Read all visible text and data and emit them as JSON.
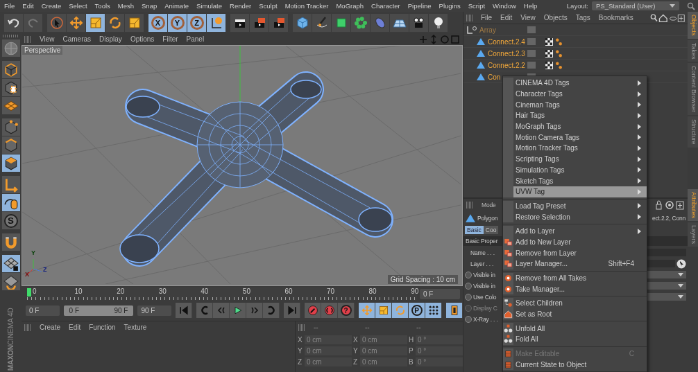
{
  "menubar": {
    "items": [
      "File",
      "Edit",
      "Create",
      "Select",
      "Tools",
      "Mesh",
      "Snap",
      "Animate",
      "Simulate",
      "Render",
      "Sculpt",
      "Motion Tracker",
      "MoGraph",
      "Character",
      "Pipeline",
      "Plugins",
      "Script",
      "Window",
      "Help"
    ],
    "layout_label": "Layout:",
    "layout_value": "PS_Standard (User)"
  },
  "toolbar": [
    [
      {
        "selected": false
      },
      {
        "selected": false
      }
    ],
    [
      {
        "selected": false
      },
      {
        "selected": false
      },
      {
        "selected": true
      },
      {
        "selected": false
      },
      {
        "selected": false
      }
    ],
    [
      {
        "label": "X",
        "selected": true
      },
      {
        "label": "Y",
        "selected": true
      },
      {
        "label": "Z",
        "selected": true
      },
      {
        "selected": true
      }
    ],
    [
      {
        "selected": false
      },
      {
        "selected": false
      },
      {
        "selected": false
      }
    ],
    [
      {
        "selected": false
      },
      {
        "selected": false
      },
      {
        "selected": false
      },
      {
        "selected": false
      },
      {
        "selected": false
      },
      {
        "selected": false
      },
      {
        "selected": false
      },
      {
        "selected": false
      }
    ]
  ],
  "left_toolbar": [
    {
      "selected": false
    },
    {
      "selected": false
    },
    {
      "selected": false
    },
    {
      "selected": false
    },
    {
      "selected": false
    },
    {
      "selected": false
    },
    {
      "selected": true
    },
    {
      "selected": false
    },
    {
      "selected": true
    },
    {
      "label": "S",
      "selected": false
    },
    {
      "selected": false
    },
    {
      "selected": true
    },
    {
      "selected": false
    }
  ],
  "viewport": {
    "menus": [
      "View",
      "Cameras",
      "Display",
      "Options",
      "Filter",
      "Panel"
    ],
    "camera": "Perspective",
    "axis_labels": [
      "Y",
      "Z",
      "X"
    ],
    "grid_spacing": "Grid Spacing : 10 cm"
  },
  "timeline": {
    "ticks": [
      "0",
      "10",
      "20",
      "30",
      "40",
      "50",
      "60",
      "70",
      "80",
      "90"
    ],
    "current_frame": "0 F",
    "start": "0 F",
    "range": {
      "start": "0 F",
      "end": "90 F",
      "level": 1
    },
    "end": "90 F",
    "controls": [
      [
        {
          "selected": false
        }
      ],
      [
        {
          "selected": false
        },
        {
          "selected": false
        },
        {
          "selected": false
        },
        {
          "selected": false
        },
        {
          "selected": false
        }
      ],
      [
        {
          "selected": false
        }
      ],
      [
        {
          "selected": false
        },
        {
          "selected": false
        },
        {
          "label": "?",
          "selected": false
        }
      ],
      [
        {
          "selected": true
        },
        {
          "selected": true
        },
        {
          "selected": true
        },
        {
          "label": "P",
          "selected": true
        },
        {
          "selected": true
        }
      ],
      [
        {
          "selected": true
        }
      ]
    ]
  },
  "material_manager": {
    "menus": [
      "Create",
      "Edit",
      "Function",
      "Texture"
    ]
  },
  "coordinates": {
    "headers": [
      "--",
      "--",
      "--"
    ],
    "rows": [
      [
        {
          "axis": "X",
          "value": "0 cm"
        },
        {
          "axis": "X",
          "value": "0 cm"
        },
        {
          "axis": "H",
          "value": "0 °"
        }
      ],
      [
        {
          "axis": "Y",
          "value": "0 cm"
        },
        {
          "axis": "Y",
          "value": "0 cm"
        },
        {
          "axis": "P",
          "value": "0 °"
        }
      ],
      [
        {
          "axis": "Z",
          "value": "0 cm"
        },
        {
          "axis": "Z",
          "value": "0 cm"
        },
        {
          "axis": "B",
          "value": "0 °"
        }
      ]
    ]
  },
  "logo": [
    "MAXON",
    "CINEMA 4D"
  ],
  "object_manager": {
    "menus": [
      "File",
      "Edit",
      "View",
      "Objects",
      "Tags",
      "Bookmarks"
    ],
    "objects": [
      {
        "name": "Array",
        "selected": false,
        "children": [
          {
            "name": "Connect.2.4",
            "selected": true,
            "tags": [
              {
                "kind": "texture"
              },
              {
                "kind": "phong"
              }
            ]
          },
          {
            "name": "Connect.2.3",
            "selected": true,
            "tags": [
              {
                "kind": "texture"
              },
              {
                "kind": "phong"
              }
            ]
          },
          {
            "name": "Connect.2.2",
            "selected": true,
            "tags": [
              {
                "kind": "texture"
              },
              {
                "kind": "phong"
              }
            ]
          },
          {
            "name": "Con",
            "selected": true
          }
        ]
      }
    ]
  },
  "attributes": {
    "mode": "Mode",
    "object": "Polygon",
    "object_names": "ect.2.2, Conn",
    "tabs": [
      {
        "label": "Basic",
        "selected": true
      },
      {
        "label": "Coo",
        "selected": false
      }
    ],
    "section": "Basic Proper",
    "fields": [
      {
        "label": "Name . . .",
        "kind": "text",
        "disabled": false
      },
      {
        "label": "Layer . . .",
        "kind": "layer",
        "disabled": false
      },
      {
        "label": "Visible in",
        "kind": "dropdown",
        "disabled": false
      },
      {
        "label": "Visible in",
        "kind": "dropdown",
        "disabled": false
      },
      {
        "label": "Use Colo",
        "kind": "dropdown",
        "disabled": false
      },
      {
        "label": "Display C",
        "kind": "radio",
        "disabled": true
      },
      {
        "label": "X-Ray . . .",
        "kind": "radio",
        "disabled": false
      }
    ]
  },
  "side_tabs": {
    "top": [
      {
        "label": "Objects",
        "selected": true
      },
      {
        "label": "Takes",
        "selected": false
      },
      {
        "label": "Content Browser",
        "selected": false
      },
      {
        "label": "Structure",
        "selected": false
      }
    ],
    "bottom": [
      {
        "label": "Attributes",
        "selected": true
      },
      {
        "label": "Layers",
        "selected": false
      }
    ]
  },
  "context_menu": {
    "sections": [
      [
        {
          "label": "CINEMA 4D Tags",
          "kind": "submenu",
          "highlighted": false,
          "disabled": false
        },
        {
          "label": "Character Tags",
          "kind": "submenu",
          "highlighted": false,
          "disabled": false
        },
        {
          "label": "Cineman Tags",
          "kind": "submenu",
          "highlighted": false,
          "disabled": false
        },
        {
          "label": "Hair Tags",
          "kind": "submenu",
          "highlighted": false,
          "disabled": false
        },
        {
          "label": "MoGraph Tags",
          "kind": "submenu",
          "highlighted": false,
          "disabled": false
        },
        {
          "label": "Motion Camera Tags",
          "kind": "submenu",
          "highlighted": false,
          "disabled": false
        },
        {
          "label": "Motion Tracker Tags",
          "kind": "submenu",
          "highlighted": false,
          "disabled": false
        },
        {
          "label": "Scripting Tags",
          "kind": "submenu",
          "highlighted": false,
          "disabled": false
        },
        {
          "label": "Simulation Tags",
          "kind": "submenu",
          "highlighted": false,
          "disabled": false
        },
        {
          "label": "Sketch Tags",
          "kind": "submenu",
          "highlighted": false,
          "disabled": false
        },
        {
          "label": "UVW Tag",
          "kind": "submenu",
          "highlighted": true,
          "disabled": false
        }
      ],
      [
        {
          "label": "Load Tag Preset",
          "kind": "submenu",
          "highlighted": false,
          "disabled": false
        },
        {
          "label": "Restore Selection",
          "kind": "submenu",
          "highlighted": false,
          "disabled": false
        }
      ],
      [
        {
          "label": "Add to Layer",
          "kind": "submenu",
          "highlighted": false,
          "disabled": false
        },
        {
          "label": "Add to New Layer",
          "kind": "command",
          "highlighted": false,
          "disabled": false
        },
        {
          "label": "Remove from Layer",
          "kind": "command",
          "highlighted": false,
          "disabled": false
        },
        {
          "label": "Layer Manager...",
          "kind": "command",
          "shortcut": "Shift+F4",
          "highlighted": false,
          "disabled": false
        }
      ],
      [
        {
          "label": "Remove from All Takes",
          "kind": "command",
          "highlighted": false,
          "disabled": false
        },
        {
          "label": "Take Manager...",
          "kind": "command",
          "highlighted": false,
          "disabled": false
        }
      ],
      [
        {
          "label": "Select Children",
          "kind": "command",
          "highlighted": false,
          "disabled": false
        },
        {
          "label": "Set as Root",
          "kind": "command",
          "highlighted": false,
          "disabled": false
        }
      ],
      [
        {
          "label": "Unfold All",
          "kind": "command",
          "highlighted": false,
          "disabled": false
        },
        {
          "label": "Fold All",
          "kind": "command",
          "highlighted": false,
          "disabled": false
        }
      ],
      [
        {
          "label": "Make Editable",
          "kind": "command",
          "shortcut": "C",
          "highlighted": false,
          "disabled": true
        },
        {
          "label": "Current State to Object",
          "kind": "command",
          "highlighted": false,
          "disabled": false
        }
      ]
    ]
  }
}
